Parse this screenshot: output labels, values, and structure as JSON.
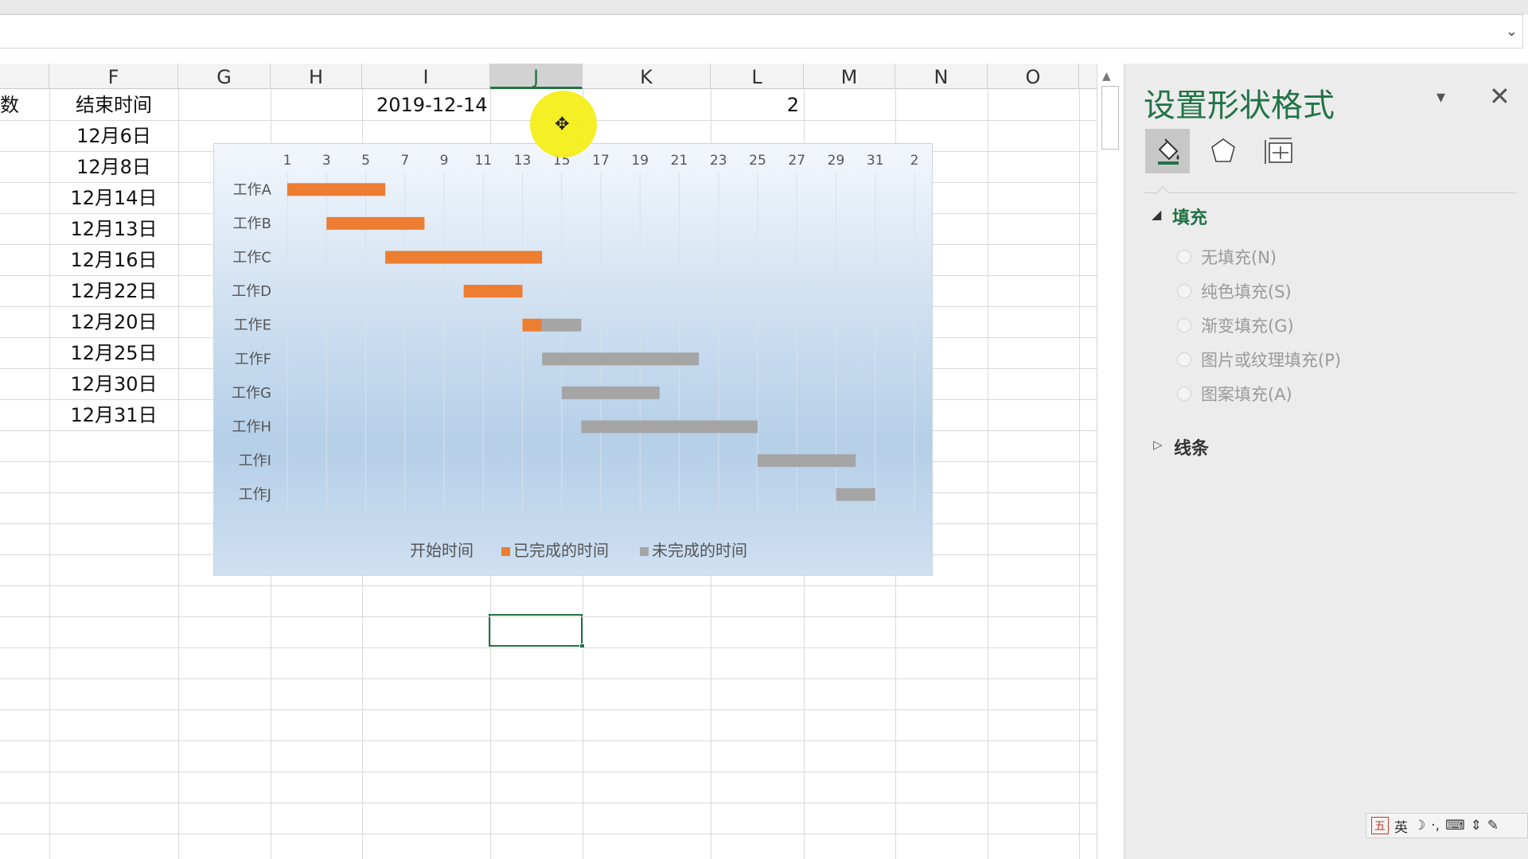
{
  "formula_bar": {
    "value": "",
    "chevron": "⌄"
  },
  "sheet": {
    "columns": [
      "F",
      "G",
      "H",
      "I",
      "J",
      "K",
      "L",
      "M",
      "N",
      "O"
    ],
    "selected_column": "J",
    "partial_header_cell": "数",
    "header_cell_F": "结束时间",
    "cell_I1": "2019-12-14",
    "cell_L1": "2",
    "end_dates": [
      "12月6日",
      "12月8日",
      "12月14日",
      "12月13日",
      "12月16日",
      "12月22日",
      "12月20日",
      "12月25日",
      "12月30日",
      "12月31日"
    ]
  },
  "chart_data": {
    "type": "bar",
    "orientation": "horizontal-stacked (gantt)",
    "categories": [
      "工作A",
      "工作B",
      "工作C",
      "工作D",
      "工作E",
      "工作F",
      "工作G",
      "工作H",
      "工作I",
      "工作J"
    ],
    "x_tick_labels": [
      "1",
      "3",
      "5",
      "7",
      "9",
      "11",
      "13",
      "15",
      "17",
      "19",
      "21",
      "23",
      "25",
      "27",
      "29",
      "31",
      "2"
    ],
    "xlim": [
      1,
      33
    ],
    "series": [
      {
        "name": "开始时间",
        "color": "none",
        "values": [
          1,
          3,
          6,
          10,
          13,
          14,
          15,
          16,
          25,
          29
        ]
      },
      {
        "name": "已完成的时间",
        "color": "#ed7d31",
        "values": [
          5,
          5,
          8,
          3,
          1,
          0,
          0,
          0,
          0,
          0
        ]
      },
      {
        "name": "未完成的时间",
        "color": "#a5a5a5",
        "values": [
          0,
          0,
          0,
          0,
          2,
          8,
          5,
          9,
          5,
          2
        ]
      }
    ],
    "legend_position": "bottom",
    "gridlines": "vertical"
  },
  "pane": {
    "title": "设置形状格式",
    "dropdown": "▾",
    "close": "✕",
    "tabs": [
      "fill-line-icon",
      "effects-icon",
      "size-properties-icon"
    ],
    "section_fill": "填充",
    "fill_options": [
      "无填充(N)",
      "纯色填充(S)",
      "渐变填充(G)",
      "图片或纹理填充(P)",
      "图案填充(A)"
    ],
    "section_line": "线条"
  },
  "ime_bar": [
    "五",
    "英",
    "☽",
    "·,",
    "⌨",
    "⇕",
    "✎"
  ],
  "colors": {
    "accent": "#217346",
    "completed": "#ed7d31",
    "incomplete": "#a5a5a5"
  }
}
